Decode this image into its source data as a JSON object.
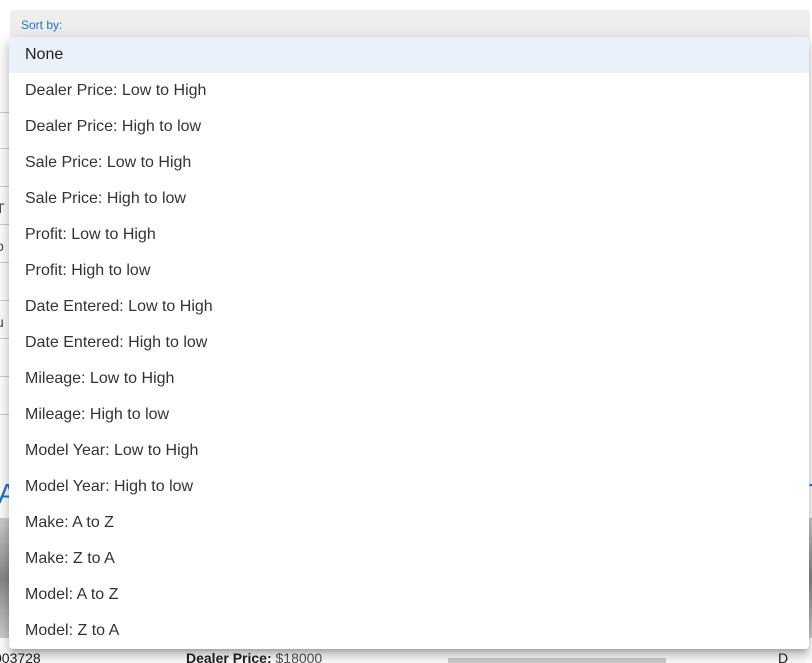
{
  "sort": {
    "label": "Sort by:",
    "selected": "None",
    "options": [
      "None",
      "Dealer Price: Low to High",
      "Dealer Price: High to low",
      "Sale Price: Low to High",
      "Sale Price: High to low",
      "Profit: Low to High",
      "Profit: High to low",
      "Date Entered: Low to High",
      "Date Entered: High to low",
      "Mileage: Low to High",
      "Mileage: High to low",
      "Model Year: Low to High",
      "Model Year: High to low",
      "Make: A to Z",
      "Make: Z to A",
      "Model: A to Z",
      "Model: Z to A"
    ]
  },
  "background": {
    "left_fragments": [
      "T",
      "o",
      "u"
    ],
    "left_big": "A",
    "right_big": "T",
    "bottom_left_code": "003728",
    "dealer_price_label": "Dealer Price:",
    "dealer_price_value": "$18000",
    "bottom_right_fragment": "D"
  },
  "colors": {
    "accent": "#1976d2",
    "selected_bg": "#eaf1fb"
  }
}
